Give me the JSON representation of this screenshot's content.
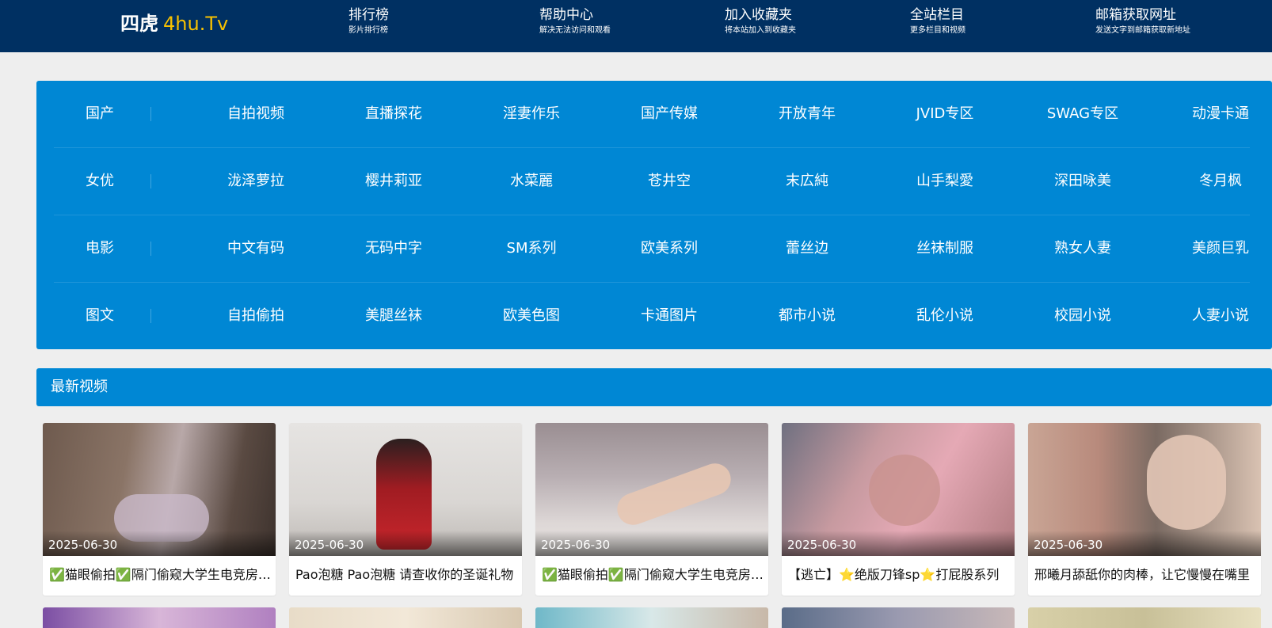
{
  "header": {
    "logo_cn": "四虎",
    "logo_en": "4hu.Tv",
    "nav": [
      {
        "label": "排行榜",
        "sub": "影片排行榜"
      },
      {
        "label": "帮助中心",
        "sub": "解决无法访问和观看"
      },
      {
        "label": "加入收藏夹",
        "sub": "将本站加入到收藏夹"
      },
      {
        "label": "全站栏目",
        "sub": "更多栏目和视频"
      },
      {
        "label": "邮箱获取网址",
        "sub": "发送文字到邮箱获取新地址"
      }
    ]
  },
  "categories": [
    {
      "label": "国产",
      "links": [
        "自拍视频",
        "直播探花",
        "淫妻作乐",
        "国产传媒",
        "开放青年",
        "JVID专区",
        "SWAG专区",
        "动漫卡通"
      ]
    },
    {
      "label": "女优",
      "links": [
        "泷泽萝拉",
        "樱井莉亚",
        "水菜麗",
        "苍井空",
        "末広純",
        "山手梨愛",
        "深田咏美",
        "冬月枫"
      ]
    },
    {
      "label": "电影",
      "links": [
        "中文有码",
        "无码中字",
        "SM系列",
        "欧美系列",
        "蕾丝边",
        "丝袜制服",
        "熟女人妻",
        "美颜巨乳"
      ]
    },
    {
      "label": "图文",
      "links": [
        "自拍偷拍",
        "美腿丝袜",
        "欧美色图",
        "卡通图片",
        "都市小说",
        "乱伦小说",
        "校园小说",
        "人妻小说"
      ]
    }
  ],
  "section": {
    "title": "最新视频"
  },
  "videos": [
    {
      "date": "2025-06-30",
      "title": "✅猫眼偷拍✅隔门偷窥大学生电竞房摄像头"
    },
    {
      "date": "2025-06-30",
      "title": "Pao泡糖 Pao泡糖 请查收你的圣诞礼物"
    },
    {
      "date": "2025-06-30",
      "title": "✅猫眼偷拍✅隔门偷窥大学生电竞房摄像头"
    },
    {
      "date": "2025-06-30",
      "title": "【逃亡】⭐绝版刀锋sp⭐打屁股系列"
    },
    {
      "date": "2025-06-30",
      "title": "邢曦月舔舐你的肉棒，让它慢慢在嘴里"
    }
  ],
  "colors": {
    "header_bg": "#003062",
    "accent_yellow": "#f7c100",
    "panel_blue": "#0087d4",
    "page_bg": "#eeeeee"
  }
}
